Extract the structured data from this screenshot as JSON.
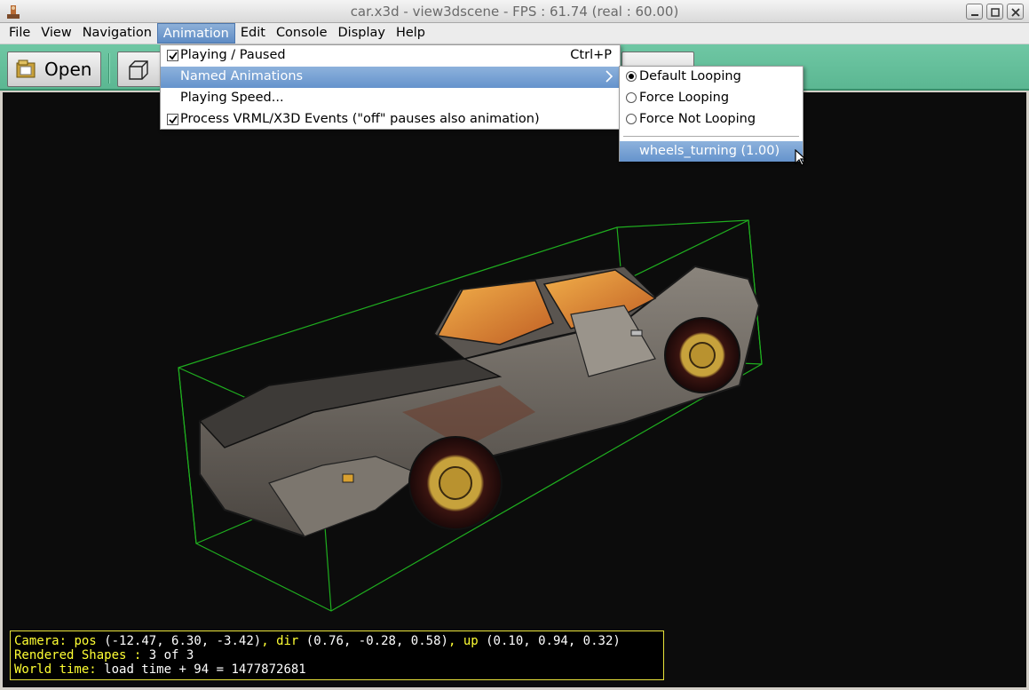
{
  "window": {
    "title": "car.x3d - view3dscene - FPS : 61.74 (real : 60.00)"
  },
  "menubar": {
    "items": [
      "File",
      "View",
      "Navigation",
      "Animation",
      "Edit",
      "Console",
      "Display",
      "Help"
    ],
    "active": "Animation"
  },
  "toolbar": {
    "open_label": "Open"
  },
  "animation_menu": {
    "items": [
      {
        "label": "Playing / Paused",
        "checked": true,
        "accel": "Ctrl+P"
      },
      {
        "label": "Named Animations",
        "submenu": true,
        "highlighted": true
      },
      {
        "label": "Playing Speed..."
      },
      {
        "label": "Process VRML/X3D Events (\"off\" pauses also animation)",
        "checked": true
      }
    ]
  },
  "named_animations_submenu": {
    "items": [
      {
        "label": "Default Looping",
        "selected": true
      },
      {
        "label": "Force Looping",
        "selected": false
      },
      {
        "label": "Force Not Looping",
        "selected": false
      }
    ],
    "animation": "wheels_turning (1.00)"
  },
  "status": {
    "camera_key": "Camera:",
    "pos_key": "pos",
    "pos_val": "(-12.47, 6.30, -3.42)",
    "dir_key": "dir",
    "dir_val": "(0.76, -0.28, 0.58)",
    "up_key": "up",
    "up_val": "(0.10, 0.94, 0.32)",
    "shapes_key": "Rendered Shapes :",
    "shapes_val": "3 of 3",
    "time_key": "World time:",
    "time_val": "load time + 94 = 1477872681"
  },
  "colors": {
    "toolbar": "#5fbb96",
    "viewport_bg": "#0c0c0c",
    "bbox": "#1fae1f",
    "status_key": "#ffff33",
    "menu_highlight": "#6f9ad0"
  }
}
